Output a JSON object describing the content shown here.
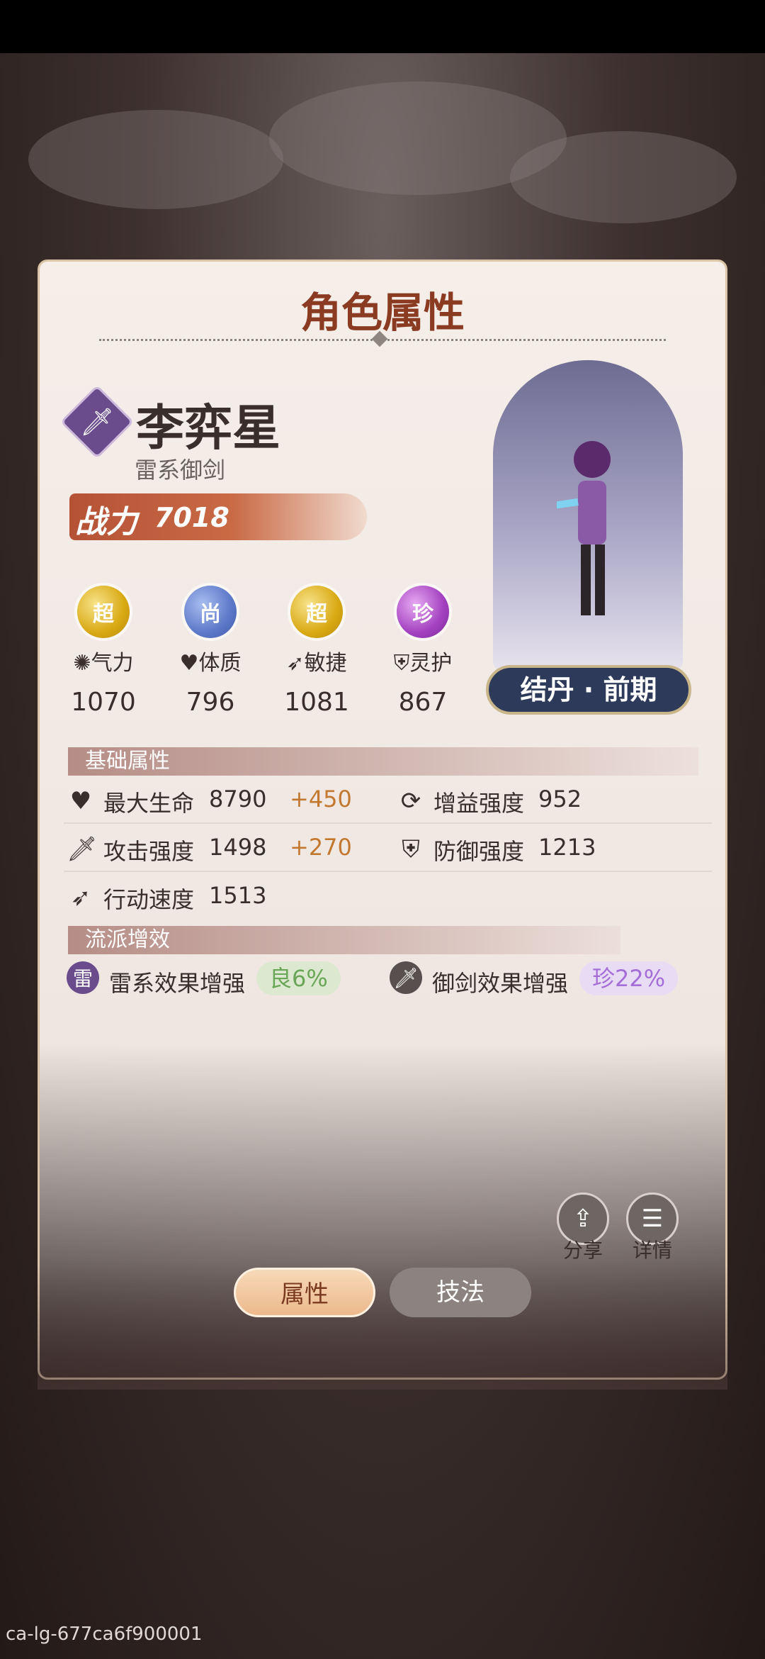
{
  "panel": {
    "title": "角色属性"
  },
  "character": {
    "class_icon": "sword-icon",
    "name": "李弈星",
    "subtitle": "雷系御剑",
    "power_label": "战力",
    "power_value": "7018",
    "realm": "结丹 · 前期"
  },
  "stats": [
    {
      "badge": "超",
      "badge_color": "gold",
      "label": "气力",
      "icon": "burst-icon",
      "value": "1070"
    },
    {
      "badge": "尚",
      "badge_color": "blue",
      "label": "体质",
      "icon": "heart-icon",
      "value": "796"
    },
    {
      "badge": "超",
      "badge_color": "gold",
      "label": "敏捷",
      "icon": "wing-icon",
      "value": "1081"
    },
    {
      "badge": "珍",
      "badge_color": "purple",
      "label": "灵护",
      "icon": "shield-icon",
      "value": "867"
    }
  ],
  "basic_section": {
    "header": "基础属性",
    "rows": [
      {
        "label": "最大生命",
        "value": "8790",
        "bonus": "+450",
        "icon": "heart-icon"
      },
      {
        "label": "攻击强度",
        "value": "1498",
        "bonus": "+270",
        "icon": "sword-icon"
      },
      {
        "label": "行动速度",
        "value": "1513",
        "icon": "wing-icon"
      },
      {
        "label": "增益强度",
        "value": "952",
        "icon": "cycle-icon"
      },
      {
        "label": "防御强度",
        "value": "1213",
        "icon": "shield-icon"
      }
    ]
  },
  "school_section": {
    "header": "流派增效",
    "items": [
      {
        "icon_text": "雷",
        "label": "雷系效果增强",
        "grade": "良6%",
        "grade_color": "green"
      },
      {
        "label": "御剑效果增强",
        "grade": "珍22%",
        "grade_color": "purple",
        "icon": "sword-icon"
      }
    ]
  },
  "actions": {
    "share": "分享",
    "details": "详情"
  },
  "tabs": {
    "attributes": "属性",
    "techniques": "技法"
  },
  "footer": {
    "id": "ca-lg-677ca6f900001"
  },
  "colors": {
    "accent": "#8a3b22",
    "bonus": "#c2782e",
    "panel": "#f3ebe6"
  }
}
